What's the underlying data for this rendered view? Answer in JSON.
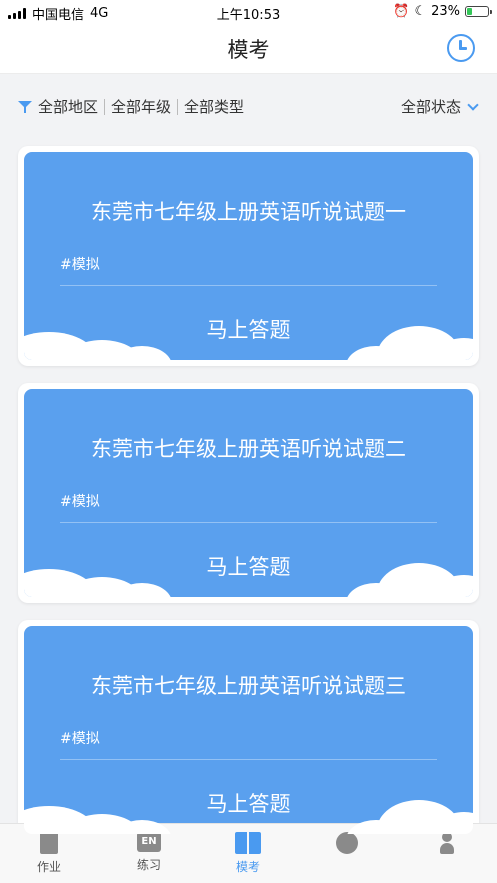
{
  "status_bar": {
    "carrier": "中国电信",
    "network": "4G",
    "time": "上午10:53",
    "battery_percent": "23%",
    "battery_level": 0.23
  },
  "nav": {
    "title": "模考",
    "history_icon": "clock-icon"
  },
  "filters": {
    "region": "全部地区",
    "grade": "全部年级",
    "type": "全部类型",
    "status": "全部状态"
  },
  "cards": [
    {
      "title": "东莞市七年级上册英语听说试题一",
      "tag": "#模拟",
      "action": "马上答题"
    },
    {
      "title": "东莞市七年级上册英语听说试题二",
      "tag": "#模拟",
      "action": "马上答题"
    },
    {
      "title": "东莞市七年级上册英语听说试题三",
      "tag": "#模拟",
      "action": "马上答题"
    }
  ],
  "tabs": [
    {
      "label": "作业",
      "icon": "homework-icon"
    },
    {
      "label": "练习",
      "icon": "en-practice-icon",
      "icon_text": "EN"
    },
    {
      "label": "模考",
      "icon": "open-book-icon",
      "active": true
    },
    {
      "label": "",
      "icon": "discover-icon"
    },
    {
      "label": "",
      "icon": "profile-icon"
    }
  ],
  "colors": {
    "accent": "#4a9af0",
    "card_blue": "#5aa0ee",
    "background": "#f2f3f5"
  }
}
